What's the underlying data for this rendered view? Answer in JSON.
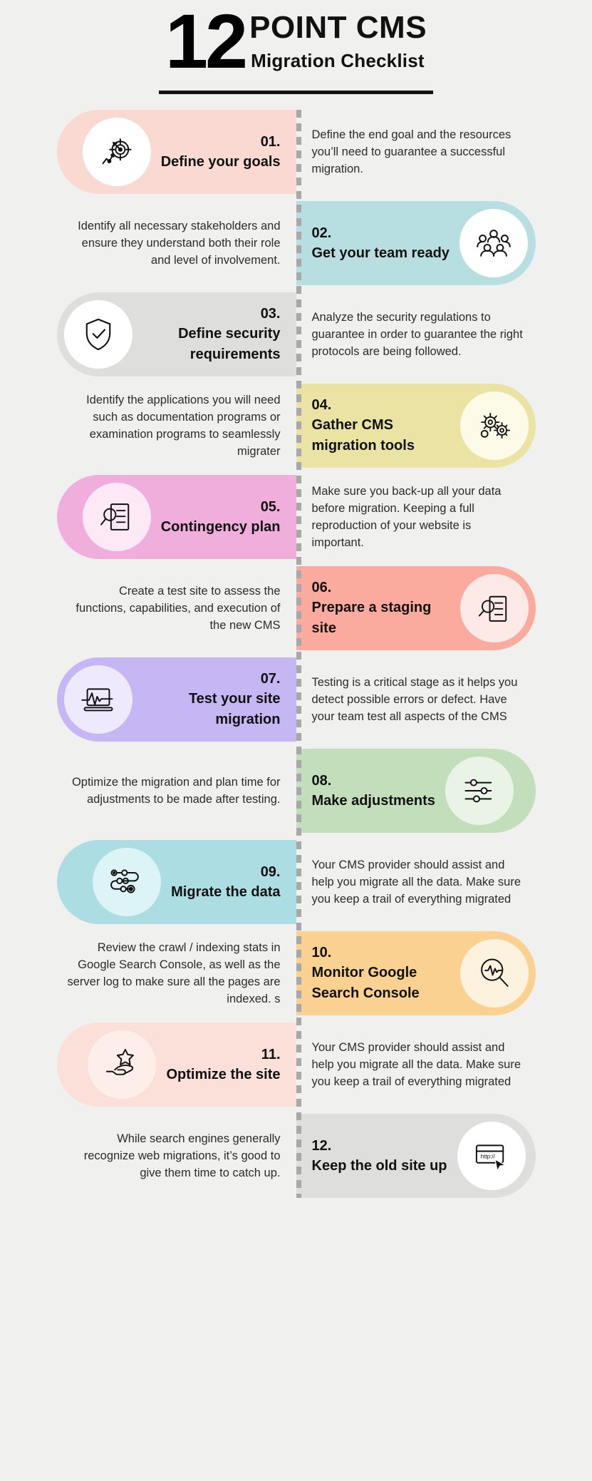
{
  "header": {
    "number": "12",
    "title_main": "POINT CMS",
    "title_sub": "Migration Checklist"
  },
  "colors": {
    "background": "#f0f0ef",
    "spine": "#a8a8a8",
    "text": "#111111",
    "body_text": "#2b2b2b"
  },
  "items": [
    {
      "number": "01.",
      "title": "Define your goals",
      "description": "Define the end goal and the resources you’ll need to guarantee a successful migration.",
      "side": "left",
      "pill_color": "#fad9d2",
      "icon_bg": "#ffffff",
      "icon": "target-goal-icon"
    },
    {
      "number": "02.",
      "title": "Get your team ready",
      "description": "Identify all necessary stakeholders and ensure they understand both their role and level of involvement.",
      "side": "right",
      "pill_color": "#b7dfe2",
      "icon_bg": "#ffffff",
      "icon": "team-group-icon"
    },
    {
      "number": "03.",
      "title": "Define security requirements",
      "description": "Analyze the security regulations to guarantee in order to guarantee the right protocols are being followed.",
      "side": "left",
      "pill_color": "#dededd",
      "icon_bg": "#ffffff",
      "icon": "shield-check-icon"
    },
    {
      "number": "04.",
      "title": "Gather CMS migration tools",
      "description": "Identify the applications you will need such as documentation programs or examination programs to seamlessly migrater",
      "side": "right",
      "pill_color": "#ebe3a4",
      "icon_bg": "#fdfbe8",
      "icon": "gears-tools-icon"
    },
    {
      "number": "05.",
      "title": "Contingency plan",
      "description": "Make sure you back-up all your data before migration. Keeping a full reproduction of your website is important.",
      "side": "left",
      "pill_color": "#f0aedd",
      "icon_bg": "#fde8f6",
      "icon": "document-search-icon"
    },
    {
      "number": "06.",
      "title": "Prepare a staging site",
      "description": "Create a test site to assess the functions, capabilities, and execution of the new CMS",
      "side": "right",
      "pill_color": "#fbab9d",
      "icon_bg": "#fdeae6",
      "icon": "magnify-document-icon"
    },
    {
      "number": "07.",
      "title": "Test your site migration",
      "description": "Testing is a critical stage as it helps you detect possible errors or defect. Have your team test all aspects of the CMS",
      "side": "left",
      "pill_color": "#c6b6f4",
      "icon_bg": "#eee9fc",
      "icon": "laptop-analytics-icon"
    },
    {
      "number": "08.",
      "title": "Make adjustments",
      "description": "Optimize the migration and plan time for adjustments to be made after testing.",
      "side": "right",
      "pill_color": "#c2debb",
      "icon_bg": "#eaf4e6",
      "icon": "sliders-settings-icon"
    },
    {
      "number": "09.",
      "title": "Migrate the data",
      "description": "Your CMS provider should assist and help you migrate all the data. Make sure you keep a trail of everything migrated",
      "side": "left",
      "pill_color": "#abdde3",
      "icon_bg": "#ddf4f7",
      "icon": "data-flow-icon"
    },
    {
      "number": "10.",
      "title": "Monitor Google Search Console",
      "description": "Review the crawl / indexing stats in Google Search Console, as well as the server log to make sure all the pages are indexed. s",
      "side": "right",
      "pill_color": "#fbd191",
      "icon_bg": "#fdf2de",
      "icon": "magnify-analytics-icon"
    },
    {
      "number": "11.",
      "title": "Optimize the site",
      "description": "Your CMS provider should assist and help you migrate all the data. Make sure you keep a trail of everything migrated",
      "side": "left",
      "pill_color": "#fbdfd9",
      "icon_bg": "#fdeeea",
      "icon": "hand-star-icon"
    },
    {
      "number": "12.",
      "title": "Keep the old site up",
      "description": "While search engines generally recognize web migrations, it’s good to give them time to catch up.",
      "side": "right",
      "pill_color": "#dededd",
      "icon_bg": "#ffffff",
      "icon": "browser-cursor-icon"
    }
  ]
}
